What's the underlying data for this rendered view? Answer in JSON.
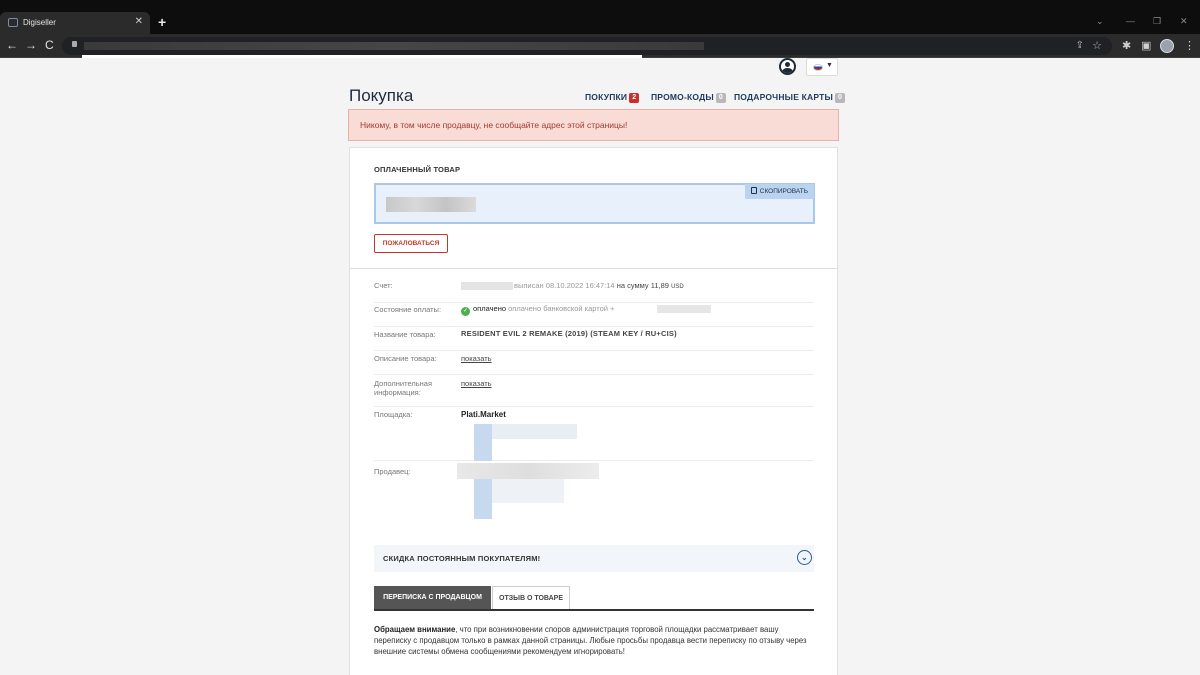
{
  "browser": {
    "tab_title": "Digiseller",
    "tab_close": "✕",
    "new_tab": "+",
    "back": "←",
    "forward": "→",
    "reload": "C"
  },
  "header": {
    "title": "Покупка",
    "links": [
      {
        "label": "ПОКУПКИ",
        "count": "2"
      },
      {
        "label": "ПРОМО-КОДЫ",
        "count": "0"
      },
      {
        "label": "ПОДАРОЧНЫЕ КАРТЫ",
        "count": "0"
      }
    ]
  },
  "warning": "Никому, в том числе продавцу, не сообщайте адрес этой страницы!",
  "paid_goods": {
    "label": "ОПЛАЧЕННЫЙ ТОВАР",
    "copy_label": "СКОПИРОВАТЬ",
    "complain_label": "ПОЖАЛОВАТЬСЯ"
  },
  "details": {
    "invoice": {
      "key": "Счет:",
      "issued": "выписан 08.10.2022 16:47:14",
      "amount_prefix": "на сумму",
      "amount": "11,89",
      "currency": "USD"
    },
    "payment": {
      "key": "Состояние оплаты:",
      "status": "оплачено",
      "method": "оплачено банковской картой +"
    },
    "product": {
      "key": "Название товара:",
      "value": "RESIDENT EVIL 2 REMAKE (2019) (STEAM KEY / RU+CIS)"
    },
    "description": {
      "key": "Описание товара:",
      "link": "показать"
    },
    "additional": {
      "key": "Дополнительная информация:",
      "link": "показать"
    },
    "platform": {
      "key": "Площадка:",
      "value": "Plati.Market"
    },
    "seller": {
      "key": "Продавец:"
    }
  },
  "discount": {
    "label": "СКИДКА ПОСТОЯННЫМ ПОКУПАТЕЛЯМ!",
    "toggle_icon": "⌄"
  },
  "tabs": [
    {
      "label": "ПЕРЕПИСКА С ПРОДАВЦОМ",
      "active": true
    },
    {
      "label": "ОТЗЫВ О ТОВАРЕ",
      "active": false
    }
  ],
  "notice": {
    "bold": "Обращаем внимание",
    "text": ", что при возникновении споров администрация торговой площадки рассматривает вашу переписку с продавцом только в рамках данной страницы. Любые просьбы продавца вести переписку по отзыву через внешние системы обмена сообщениями рекомендуем игнорировать!"
  },
  "colors": {
    "accent": "#2a6db0",
    "warning_bg": "#f9dcd6",
    "danger": "#c0392b",
    "success": "#4caf50"
  }
}
